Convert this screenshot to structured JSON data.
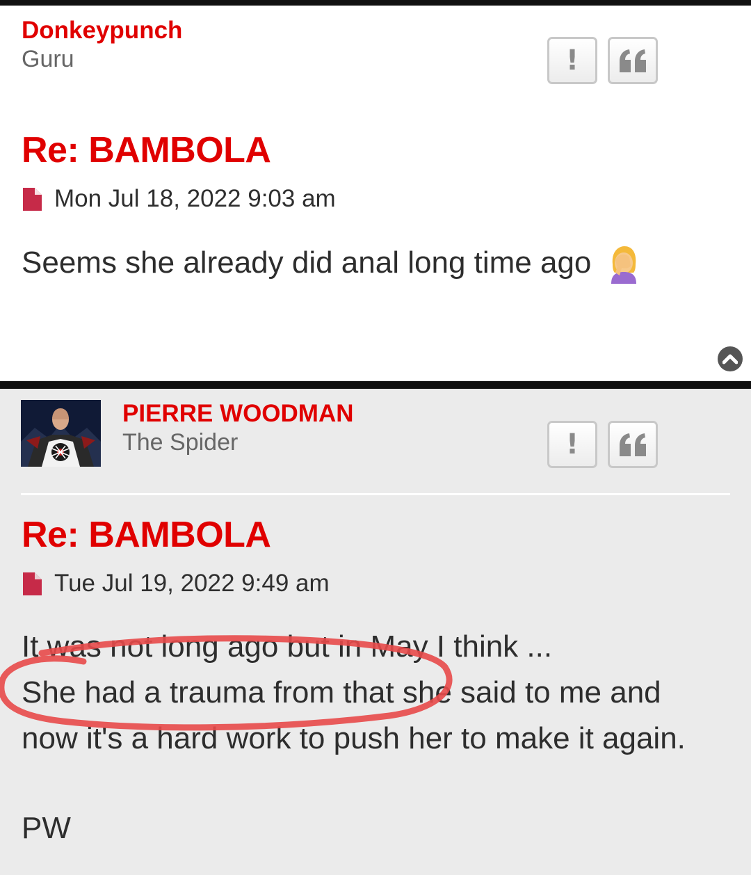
{
  "posts": [
    {
      "username": "Donkeypunch",
      "rank": "Guru",
      "report_label": "!",
      "title": "Re: BAMBOLA",
      "date": "Mon Jul 18, 2022 9:03 am",
      "body": [
        "Seems she already did anal long time ago"
      ],
      "emoji": "facepalm-emoji"
    },
    {
      "username": "PIERRE WOODMAN",
      "rank": "The Spider",
      "report_label": "!",
      "title": "Re: BAMBOLA",
      "date": "Tue Jul 19, 2022 9:49 am",
      "body": [
        "It was not long ago but in May I think ...",
        "She had a trauma from that she said to me and",
        "now it's a hard work to push her to make it again."
      ],
      "signature": "PW"
    }
  ],
  "colors": {
    "accent": "#e00000",
    "post2_bg": "#ebebeb",
    "annotation": "#e84a4a"
  },
  "icons": [
    "report-icon",
    "quote-icon",
    "document-icon",
    "back-to-top-icon"
  ]
}
